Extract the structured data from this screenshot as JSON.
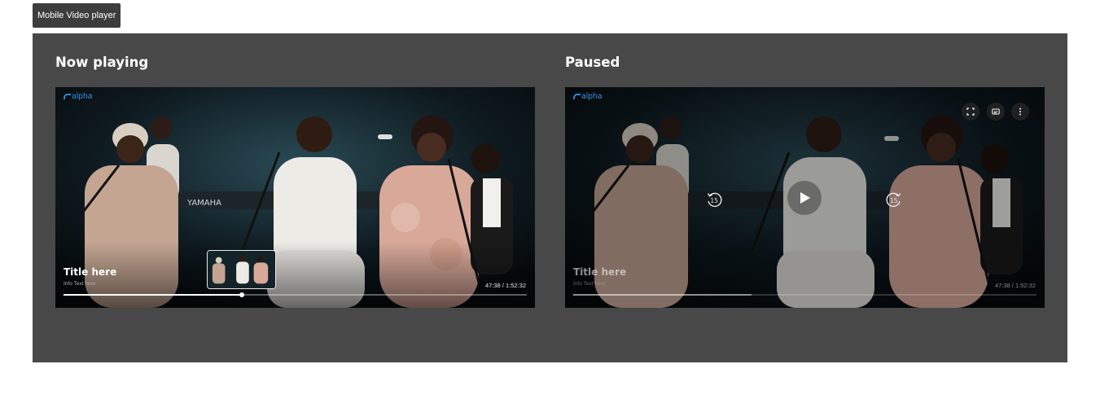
{
  "frame_label": "Mobile Video player",
  "playing": {
    "heading": "Now playing",
    "brand": "alpha",
    "title": "Title here",
    "info": "Info Text here",
    "time": "47:38 / 1:52:32",
    "progress": 0.385
  },
  "paused": {
    "heading": "Paused",
    "brand": "alpha",
    "title": "Title here",
    "info": "Info Text here",
    "time": "47:38 / 1:52:32",
    "progress": 0.385,
    "skip_back_label": "15",
    "skip_forward_label": "15",
    "icons": [
      "fullscreen-icon",
      "captions-icon",
      "more-vertical-icon",
      "play-icon",
      "rewind-15-icon",
      "forward-15-icon"
    ]
  },
  "colors": {
    "canvas": "#484848",
    "brand_blue": "#3b8fe0",
    "progress_fill": "#ffffff"
  }
}
